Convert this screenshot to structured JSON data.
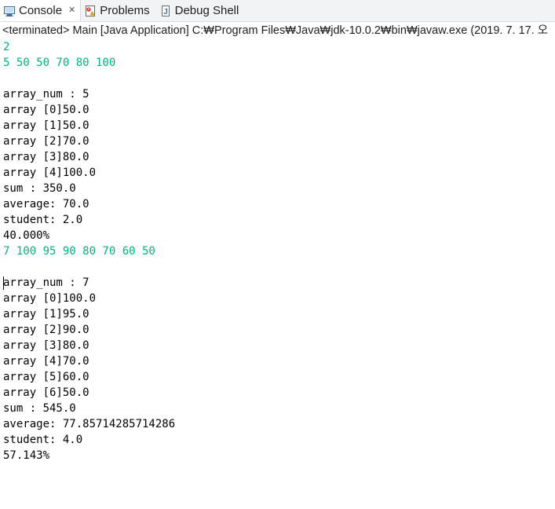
{
  "tabs": [
    {
      "label": "Console",
      "icon": "console-icon",
      "active": true
    },
    {
      "label": "Problems",
      "icon": "problems-icon",
      "active": false
    },
    {
      "label": "Debug Shell",
      "icon": "debug-shell-icon",
      "active": false
    }
  ],
  "colors": {
    "input_text": "#00b380",
    "output_text": "#000000"
  },
  "status": {
    "text": "<terminated> Main [Java Application] C:₩Program Files₩Java₩jdk-10.0.2₩bin₩javaw.exe (2019. 7. 17. 오"
  },
  "console": {
    "lines": [
      {
        "text": "2",
        "type": "input"
      },
      {
        "text": "5 50 50 70 80 100",
        "type": "input"
      },
      {
        "text": "",
        "type": "output"
      },
      {
        "text": "array_num : 5",
        "type": "output"
      },
      {
        "text": "array [0]50.0",
        "type": "output"
      },
      {
        "text": "array [1]50.0",
        "type": "output"
      },
      {
        "text": "array [2]70.0",
        "type": "output"
      },
      {
        "text": "array [3]80.0",
        "type": "output"
      },
      {
        "text": "array [4]100.0",
        "type": "output"
      },
      {
        "text": "sum : 350.0",
        "type": "output"
      },
      {
        "text": "average: 70.0",
        "type": "output"
      },
      {
        "text": "student: 2.0",
        "type": "output"
      },
      {
        "text": "40.000%",
        "type": "output"
      },
      {
        "text": "7 100 95 90 80 70 60 50",
        "type": "input"
      },
      {
        "text": "",
        "type": "output"
      },
      {
        "text": "array_num : 7",
        "type": "output"
      },
      {
        "text": "array [0]100.0",
        "type": "output"
      },
      {
        "text": "array [1]95.0",
        "type": "output"
      },
      {
        "text": "array [2]90.0",
        "type": "output"
      },
      {
        "text": "array [3]80.0",
        "type": "output"
      },
      {
        "text": "array [4]70.0",
        "type": "output"
      },
      {
        "text": "array [5]60.0",
        "type": "output"
      },
      {
        "text": "array [6]50.0",
        "type": "output"
      },
      {
        "text": "sum : 545.0",
        "type": "output"
      },
      {
        "text": "average: 77.85714285714286",
        "type": "output"
      },
      {
        "text": "student: 4.0",
        "type": "output"
      },
      {
        "text": "57.143%",
        "type": "output"
      }
    ]
  }
}
